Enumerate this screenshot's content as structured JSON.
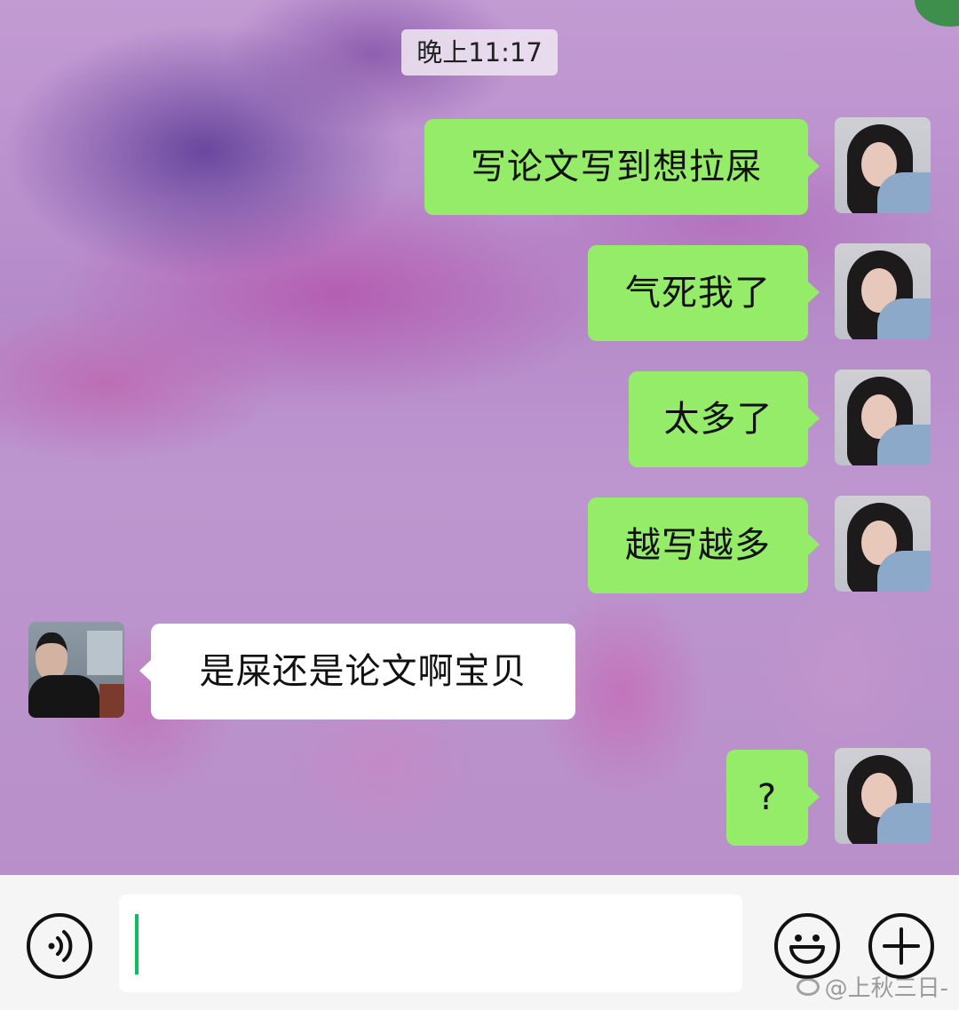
{
  "chat": {
    "timestamp": "晚上11:17",
    "messages": [
      {
        "sender": "me",
        "text": "写论文写到想拉屎"
      },
      {
        "sender": "me",
        "text": "气死我了"
      },
      {
        "sender": "me",
        "text": "太多了"
      },
      {
        "sender": "me",
        "text": "越写越多"
      },
      {
        "sender": "other",
        "text": "是屎还是论文啊宝贝"
      },
      {
        "sender": "me",
        "text": "?"
      }
    ]
  },
  "input_bar": {
    "value": "",
    "icons": [
      "voice-icon",
      "emoji-icon",
      "plus-icon"
    ]
  },
  "watermark": {
    "text": "@上秋三日-"
  },
  "colors": {
    "sent_bubble": "#95ec69",
    "received_bubble": "#ffffff",
    "caret": "#07c160",
    "input_bar_bg": "#f5f5f5"
  }
}
